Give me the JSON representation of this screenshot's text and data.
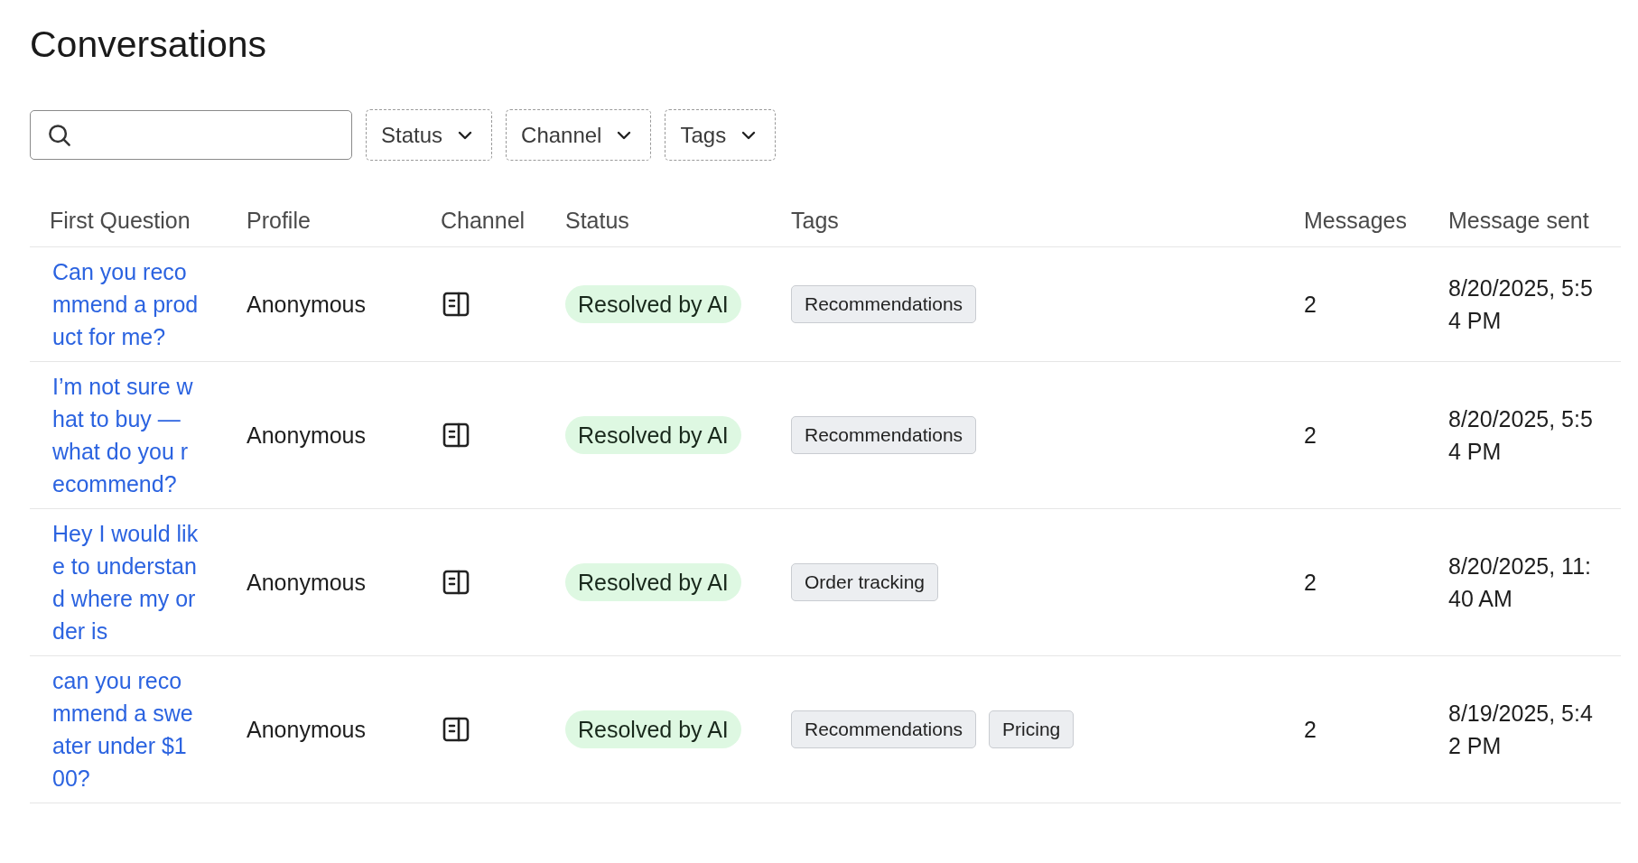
{
  "page": {
    "title": "Conversations"
  },
  "filters": [
    {
      "label": "Status"
    },
    {
      "label": "Channel"
    },
    {
      "label": "Tags"
    }
  ],
  "table": {
    "columns": [
      "First Question",
      "Profile",
      "Channel",
      "Status",
      "Tags",
      "Messages",
      "Message sent"
    ],
    "rows": [
      {
        "first_question": "Can you recommend a product for me?",
        "profile": "Anonymous",
        "status": "Resolved by AI",
        "tags": [
          "Recommendations"
        ],
        "messages": "2",
        "message_sent": "8/20/2025, 5:54 PM"
      },
      {
        "first_question": "I’m not sure what to buy — what do you recommend?",
        "profile": "Anonymous",
        "status": "Resolved by AI",
        "tags": [
          "Recommendations"
        ],
        "messages": "2",
        "message_sent": "8/20/2025, 5:54 PM"
      },
      {
        "first_question": "Hey I would like to understand where my order is",
        "profile": "Anonymous",
        "status": "Resolved by AI",
        "tags": [
          "Order tracking"
        ],
        "messages": "2",
        "message_sent": "8/20/2025, 11:40 AM"
      },
      {
        "first_question": "can you recommend a sweater under $100?",
        "profile": "Anonymous",
        "status": "Resolved by AI",
        "tags": [
          "Recommendations",
          "Pricing"
        ],
        "messages": "2",
        "message_sent": "8/19/2025, 5:42 PM"
      }
    ]
  }
}
